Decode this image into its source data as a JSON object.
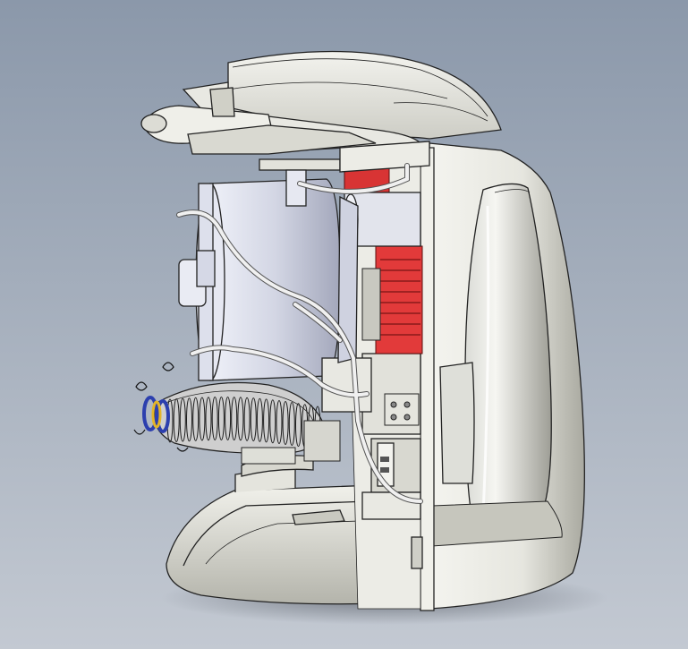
{
  "scene": {
    "subject": "coffee-brewer-cad-cutaway",
    "colors": {
      "bg_top": "#8b98aa",
      "bg_bottom": "#c3c9d2",
      "shell": "#e9e9e3",
      "shell_shade": "#b9b9b0",
      "shell_dark": "#8e8e86",
      "metal": "#d6d9e6",
      "metal_shade": "#9da2b8",
      "accent_red": "#e23a3a",
      "accent_red_dark": "#9c1f1f",
      "coil_blue": "#2c3fae",
      "coil_yellow": "#e3b52a",
      "outline": "#222222",
      "tube": "#eeeeee"
    }
  }
}
